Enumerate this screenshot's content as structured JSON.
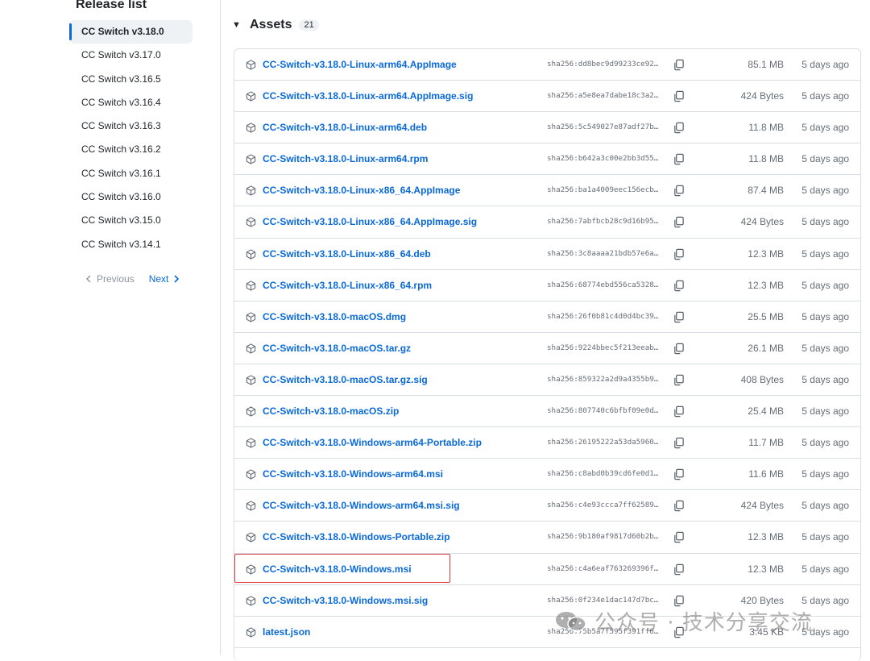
{
  "sidebar": {
    "title": "Release list",
    "releases": [
      "CC Switch v3.18.0",
      "CC Switch v3.17.0",
      "CC Switch v3.16.5",
      "CC Switch v3.16.4",
      "CC Switch v3.16.3",
      "CC Switch v3.16.2",
      "CC Switch v3.16.1",
      "CC Switch v3.16.0",
      "CC Switch v3.15.0",
      "CC Switch v3.14.1"
    ],
    "active_index": 0,
    "pagination": {
      "previous": "Previous",
      "next": "Next"
    }
  },
  "assets": {
    "title": "Assets",
    "count": "21",
    "rows": [
      {
        "name": "CC-Switch-v3.18.0-Linux-arm64.AppImage",
        "sha": "sha256:dd8bec9d99233ce92…",
        "size": "85.1 MB",
        "date": "5 days ago"
      },
      {
        "name": "CC-Switch-v3.18.0-Linux-arm64.AppImage.sig",
        "sha": "sha256:a5e8ea7dabe18c3a2…",
        "size": "424 Bytes",
        "date": "5 days ago"
      },
      {
        "name": "CC-Switch-v3.18.0-Linux-arm64.deb",
        "sha": "sha256:5c549027e87adf27b…",
        "size": "11.8 MB",
        "date": "5 days ago"
      },
      {
        "name": "CC-Switch-v3.18.0-Linux-arm64.rpm",
        "sha": "sha256:b642a3c00e2bb3d55…",
        "size": "11.8 MB",
        "date": "5 days ago"
      },
      {
        "name": "CC-Switch-v3.18.0-Linux-x86_64.AppImage",
        "sha": "sha256:ba1a4009eec156ecb…",
        "size": "87.4 MB",
        "date": "5 days ago"
      },
      {
        "name": "CC-Switch-v3.18.0-Linux-x86_64.AppImage.sig",
        "sha": "sha256:7abfbcb28c9d16b95…",
        "size": "424 Bytes",
        "date": "5 days ago"
      },
      {
        "name": "CC-Switch-v3.18.0-Linux-x86_64.deb",
        "sha": "sha256:3c8aaaa21bdb57e6a…",
        "size": "12.3 MB",
        "date": "5 days ago"
      },
      {
        "name": "CC-Switch-v3.18.0-Linux-x86_64.rpm",
        "sha": "sha256:68774ebd556ca5328…",
        "size": "12.3 MB",
        "date": "5 days ago"
      },
      {
        "name": "CC-Switch-v3.18.0-macOS.dmg",
        "sha": "sha256:26f0b81c4d0d4bc39…",
        "size": "25.5 MB",
        "date": "5 days ago"
      },
      {
        "name": "CC-Switch-v3.18.0-macOS.tar.gz",
        "sha": "sha256:9224bbec5f213eeab…",
        "size": "26.1 MB",
        "date": "5 days ago"
      },
      {
        "name": "CC-Switch-v3.18.0-macOS.tar.gz.sig",
        "sha": "sha256:859322a2d9a4355b9…",
        "size": "408 Bytes",
        "date": "5 days ago"
      },
      {
        "name": "CC-Switch-v3.18.0-macOS.zip",
        "sha": "sha256:807740c6bfbf09e0d…",
        "size": "25.4 MB",
        "date": "5 days ago"
      },
      {
        "name": "CC-Switch-v3.18.0-Windows-arm64-Portable.zip",
        "sha": "sha256:26195222a53da5960…",
        "size": "11.7 MB",
        "date": "5 days ago"
      },
      {
        "name": "CC-Switch-v3.18.0-Windows-arm64.msi",
        "sha": "sha256:c8abd0b39cd6fe0d1…",
        "size": "11.6 MB",
        "date": "5 days ago"
      },
      {
        "name": "CC-Switch-v3.18.0-Windows-arm64.msi.sig",
        "sha": "sha256:c4e93ccca7ff62589…",
        "size": "424 Bytes",
        "date": "5 days ago"
      },
      {
        "name": "CC-Switch-v3.18.0-Windows-Portable.zip",
        "sha": "sha256:9b180af9817d60b2b…",
        "size": "12.3 MB",
        "date": "5 days ago"
      },
      {
        "name": "CC-Switch-v3.18.0-Windows.msi",
        "sha": "sha256:c4a6eaf763269396f…",
        "size": "12.3 MB",
        "date": "5 days ago"
      },
      {
        "name": "CC-Switch-v3.18.0-Windows.msi.sig",
        "sha": "sha256:0f234e1dac147d7bc…",
        "size": "420 Bytes",
        "date": "5 days ago"
      },
      {
        "name": "latest.json",
        "sha": "sha256:75b5a7f595f391ff6…",
        "size": "3.45 KB",
        "date": "5 days ago"
      },
      {
        "name": "",
        "sha": "",
        "size": "",
        "date": ""
      }
    ],
    "highlighted_index": 16
  },
  "watermark": {
    "text": "公众号 · 技术分享交流"
  },
  "colors": {
    "link": "#0969da",
    "muted": "#656d76",
    "border": "#d8dee4",
    "highlight": "#e0393e",
    "active_bar": "#0969da"
  }
}
